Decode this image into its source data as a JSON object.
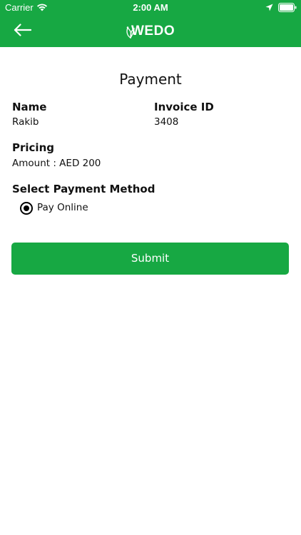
{
  "status_bar": {
    "carrier": "Carrier",
    "time": "2:00 AM",
    "icons": [
      "wifi-icon",
      "location-icon",
      "battery-icon"
    ]
  },
  "header": {
    "logo": "WEDO",
    "back_icon": "back-arrow-icon"
  },
  "page": {
    "title": "Payment"
  },
  "details": {
    "name_label": "Name",
    "name_value": "Rakib",
    "invoice_label": "Invoice ID",
    "invoice_value": "3408",
    "pricing_label": "Pricing",
    "amount_text": "Amount : AED 200"
  },
  "payment_method": {
    "label": "Select Payment Method",
    "options": [
      {
        "label": "Pay Online",
        "selected": true
      }
    ]
  },
  "actions": {
    "submit_label": "Submit"
  },
  "colors": {
    "brand_green": "#17a843",
    "text": "#111111",
    "background": "#ffffff"
  }
}
